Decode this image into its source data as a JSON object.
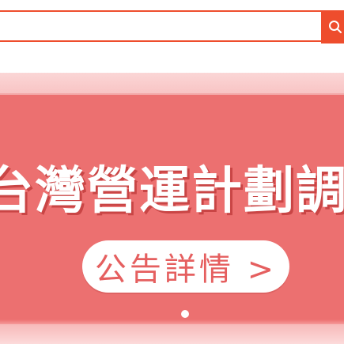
{
  "search": {
    "placeholder": "",
    "value": "",
    "button_icon": "search-icon"
  },
  "banner": {
    "title": "台灣營運計劃調",
    "button_label": "公告詳情 >",
    "slide_count_visible": 1,
    "active_slide": 1
  },
  "colors": {
    "accent": "#ee4d2d",
    "banner_bg": "#ec7070",
    "banner_light": "#fbd3d3",
    "pill_text": "#e55f5f"
  }
}
